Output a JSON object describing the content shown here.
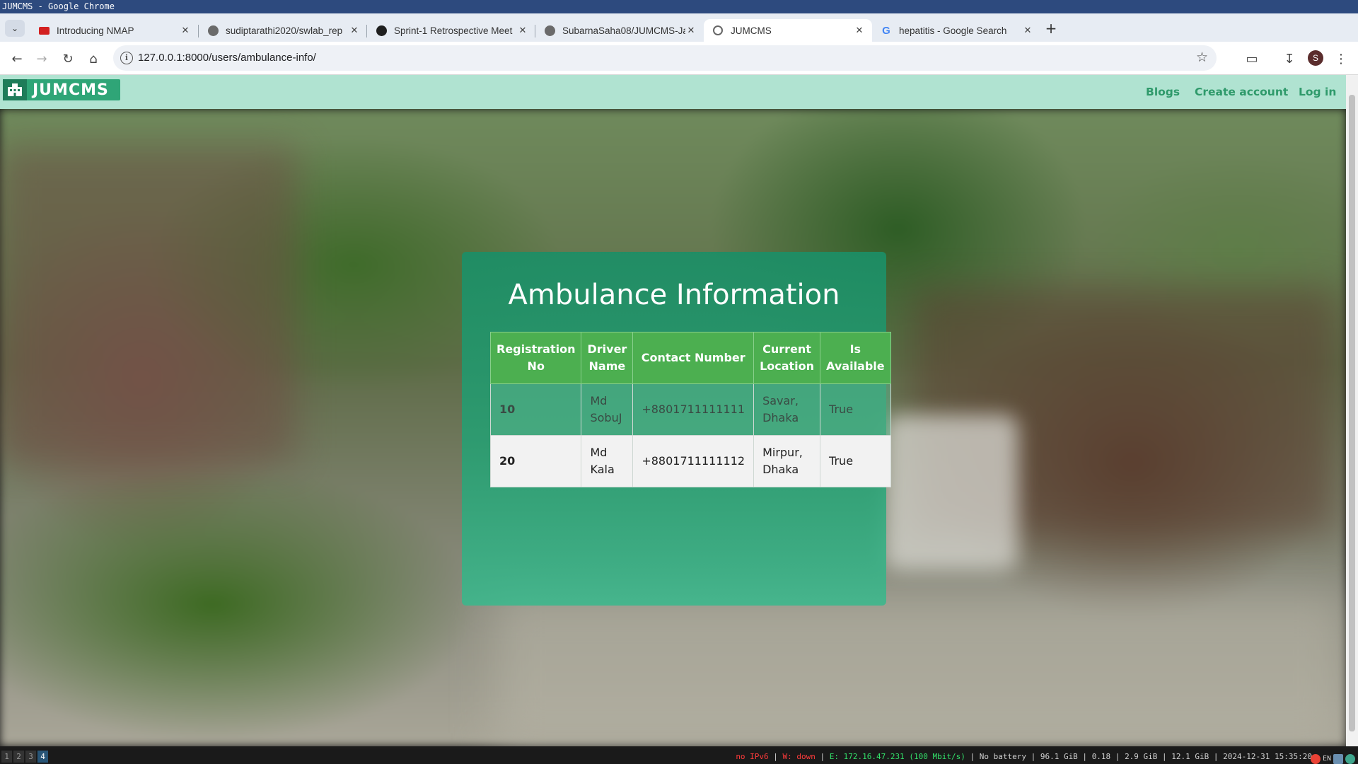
{
  "window": {
    "title": "JUMCMS - Google Chrome"
  },
  "tabs": [
    {
      "title": "Introducing NMAP",
      "favicon": "nmap-icon",
      "active": false
    },
    {
      "title": "sudiptarathi2020/swlab_rep",
      "favicon": "github-icon",
      "active": false
    },
    {
      "title": "Sprint-1 Retrospective Meet",
      "favicon": "github-icon",
      "active": false
    },
    {
      "title": "SubarnaSaha08/JUMCMS-Ja",
      "favicon": "github-icon",
      "active": false
    },
    {
      "title": "JUMCMS",
      "favicon": "globe-icon",
      "active": true
    },
    {
      "title": "hepatitis - Google Search",
      "favicon": "google-icon",
      "active": false
    }
  ],
  "toolbar": {
    "url": "127.0.0.1:8000/users/ambulance-info/",
    "profile_initial": "S"
  },
  "site": {
    "logo_text": "JUMCMS",
    "nav": {
      "blogs": "Blogs",
      "create_account": "Create account",
      "login": "Log in"
    }
  },
  "card": {
    "title": "Ambulance Information",
    "columns": [
      "Registration No",
      "Driver Name",
      "Contact Number",
      "Current Location",
      "Is Available"
    ],
    "rows": [
      {
        "reg_no": "10",
        "driver": "Md SobuJ",
        "contact": "+8801711111111",
        "location": "Savar, Dhaka",
        "available": "True"
      },
      {
        "reg_no": "20",
        "driver": "Md Kala",
        "contact": "+8801711111112",
        "location": "Mirpur, Dhaka",
        "available": "True"
      }
    ]
  },
  "statusbar": {
    "workspaces": [
      "1",
      "2",
      "3",
      "4"
    ],
    "active_workspace": "4",
    "ipv6": "no IPv6",
    "wifi": "W: down",
    "ethernet": "E: 172.16.47.231 (100 Mbit/s)",
    "battery": "No battery",
    "disk": "96.1 GiB",
    "load": "0.18",
    "mem_used": "2.9 GiB",
    "mem_free": "12.1 GiB",
    "datetime": "2024-12-31 15:35:20",
    "lang": "EN"
  },
  "colors": {
    "navbar_bg": "#b0e3d1",
    "brand_green": "#2f9a6b",
    "table_header": "#4caf50",
    "card_green": "#1c8e66"
  }
}
